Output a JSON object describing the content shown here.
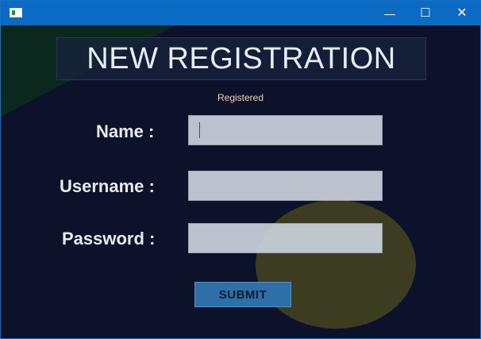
{
  "window": {
    "controls": {
      "minimize_symbol": "—",
      "maximize_symbol": "☐",
      "close_symbol": "✕"
    }
  },
  "form": {
    "title": "NEW REGISTRATION",
    "status": "Registered",
    "fields": [
      {
        "label": "Name :",
        "value": "",
        "focused": true
      },
      {
        "label": "Username :",
        "value": ""
      },
      {
        "label": "Password :",
        "value": ""
      }
    ],
    "submit_label": "SUBMIT"
  },
  "colors": {
    "titlebar": "#0a6ac4",
    "background": "#0b1229",
    "input_bg": "#cbd1dc",
    "button_bg": "#2f6fa8",
    "status_text": "#f0d6b0",
    "green_shape": "#0c2a1d",
    "yellow_circle": "#45451e"
  },
  "icons": [
    "app-icon",
    "minimize-icon",
    "maximize-icon",
    "close-icon"
  ]
}
